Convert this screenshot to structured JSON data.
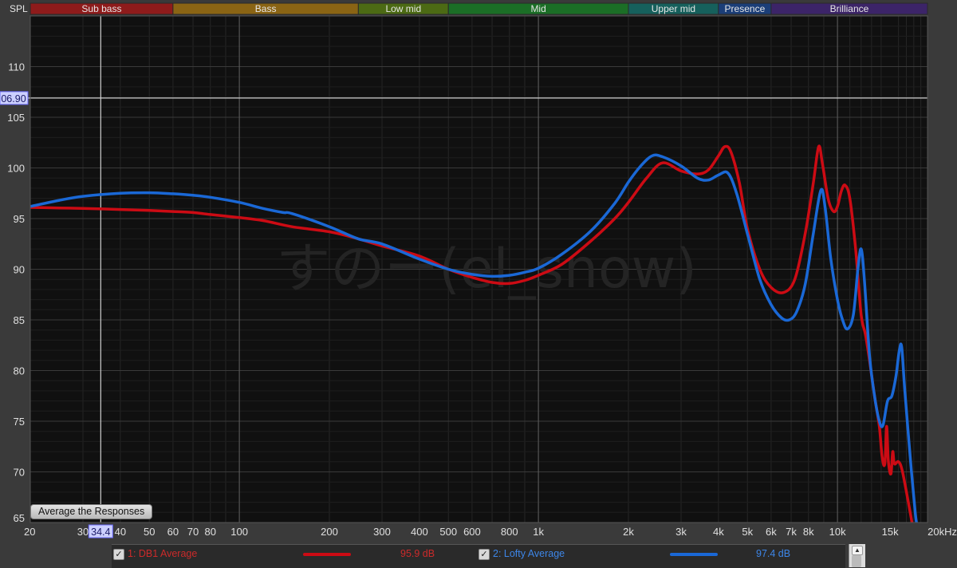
{
  "chart_data": {
    "type": "line",
    "y_axis_title": "SPL",
    "x_axis_unit": "Hz",
    "x_scale": "log",
    "xlim": [
      20,
      20000
    ],
    "ylim": [
      65,
      115
    ],
    "y_ticks": [
      65,
      70,
      75,
      80,
      85,
      90,
      95,
      100,
      105,
      110
    ],
    "y_tick_labels": [
      "65",
      "70",
      "75",
      "80",
      "85",
      "90",
      "95",
      "100",
      "105",
      "110"
    ],
    "x_ticks": [
      20,
      30,
      40,
      50,
      60,
      70,
      80,
      100,
      200,
      300,
      400,
      500,
      600,
      800,
      1000,
      2000,
      3000,
      4000,
      5000,
      6000,
      7000,
      8000,
      10000,
      15000,
      20000
    ],
    "x_tick_labels": [
      "20",
      "30",
      "40",
      "50",
      "60",
      "70",
      "80",
      "100",
      "200",
      "300",
      "400",
      "500",
      "600",
      "800",
      "1k",
      "2k",
      "3k",
      "4k",
      "5k",
      "6k",
      "7k",
      "8k",
      "10k",
      "15k",
      "20kHz"
    ],
    "grid": true,
    "watermark": "すのー(el_snow)",
    "cursor": {
      "freq": 34.4,
      "freq_label": "34.4",
      "spl": 106.9,
      "spl_label": "06.90"
    },
    "bands": [
      {
        "name": "Sub bass",
        "from": 20,
        "to": 60,
        "color": "#8e1b1b"
      },
      {
        "name": "Bass",
        "from": 60,
        "to": 250,
        "color": "#8a6414"
      },
      {
        "name": "Low mid",
        "from": 250,
        "to": 500,
        "color": "#4c6a14"
      },
      {
        "name": "Mid",
        "from": 500,
        "to": 2000,
        "color": "#1b6e26"
      },
      {
        "name": "Upper mid",
        "from": 2000,
        "to": 4000,
        "color": "#16605c"
      },
      {
        "name": "Presence",
        "from": 4000,
        "to": 6000,
        "color": "#1b3e78"
      },
      {
        "name": "Brilliance",
        "from": 6000,
        "to": 20000,
        "color": "#3c2468"
      }
    ],
    "series": [
      {
        "name": "1: DB1 Average",
        "color": "#cc0b14",
        "value_label": "95.9 dB",
        "points": [
          [
            20,
            96.1
          ],
          [
            25,
            96.05
          ],
          [
            30,
            96.0
          ],
          [
            40,
            95.9
          ],
          [
            50,
            95.8
          ],
          [
            60,
            95.7
          ],
          [
            70,
            95.6
          ],
          [
            80,
            95.4
          ],
          [
            100,
            95.1
          ],
          [
            120,
            94.8
          ],
          [
            150,
            94.2
          ],
          [
            200,
            93.7
          ],
          [
            250,
            93.0
          ],
          [
            300,
            92.3
          ],
          [
            400,
            91.3
          ],
          [
            500,
            90.0
          ],
          [
            600,
            89.2
          ],
          [
            700,
            88.7
          ],
          [
            800,
            88.6
          ],
          [
            900,
            88.9
          ],
          [
            1000,
            89.4
          ],
          [
            1200,
            90.5
          ],
          [
            1500,
            92.8
          ],
          [
            1800,
            95.0
          ],
          [
            2000,
            96.6
          ],
          [
            2300,
            99.0
          ],
          [
            2600,
            100.5
          ],
          [
            3000,
            99.7
          ],
          [
            3400,
            99.4
          ],
          [
            3700,
            99.8
          ],
          [
            4000,
            101.2
          ],
          [
            4200,
            102.1
          ],
          [
            4400,
            101.6
          ],
          [
            4700,
            98.5
          ],
          [
            5000,
            94.0
          ],
          [
            5500,
            90.0
          ],
          [
            6000,
            88.2
          ],
          [
            6600,
            87.7
          ],
          [
            7200,
            89.0
          ],
          [
            7800,
            93.5
          ],
          [
            8300,
            98.5
          ],
          [
            8650,
            102.1
          ],
          [
            8900,
            100.5
          ],
          [
            9300,
            97.0
          ],
          [
            9700,
            95.7
          ],
          [
            10000,
            96.2
          ],
          [
            10300,
            97.7
          ],
          [
            10600,
            98.3
          ],
          [
            11000,
            97.0
          ],
          [
            11500,
            92.0
          ],
          [
            12000,
            85.5
          ],
          [
            12400,
            83.6
          ],
          [
            12800,
            81.0
          ],
          [
            13300,
            77.5
          ],
          [
            13800,
            74.5
          ],
          [
            14100,
            71.5
          ],
          [
            14400,
            70.8
          ],
          [
            14600,
            74.5
          ],
          [
            14800,
            71.0
          ],
          [
            15100,
            69.8
          ],
          [
            15300,
            72.0
          ],
          [
            15500,
            70.8
          ],
          [
            16000,
            71.0
          ],
          [
            16500,
            70.0
          ],
          [
            17500,
            66.0
          ],
          [
            18000,
            64.0
          ]
        ]
      },
      {
        "name": "2: Lofty Average",
        "color": "#1a68d6",
        "value_label": "97.4 dB",
        "points": [
          [
            20,
            96.2
          ],
          [
            25,
            96.8
          ],
          [
            30,
            97.2
          ],
          [
            40,
            97.5
          ],
          [
            50,
            97.55
          ],
          [
            60,
            97.45
          ],
          [
            70,
            97.3
          ],
          [
            80,
            97.1
          ],
          [
            100,
            96.6
          ],
          [
            120,
            96.0
          ],
          [
            140,
            95.6
          ],
          [
            150,
            95.5
          ],
          [
            200,
            94.2
          ],
          [
            250,
            93.0
          ],
          [
            300,
            92.5
          ],
          [
            400,
            91.0
          ],
          [
            500,
            90.0
          ],
          [
            600,
            89.5
          ],
          [
            700,
            89.3
          ],
          [
            800,
            89.4
          ],
          [
            900,
            89.7
          ],
          [
            1000,
            90.1
          ],
          [
            1200,
            91.5
          ],
          [
            1500,
            93.8
          ],
          [
            1800,
            96.5
          ],
          [
            2000,
            98.6
          ],
          [
            2200,
            100.2
          ],
          [
            2400,
            101.2
          ],
          [
            2600,
            101.1
          ],
          [
            3000,
            100.2
          ],
          [
            3400,
            99.0
          ],
          [
            3700,
            98.8
          ],
          [
            4000,
            99.3
          ],
          [
            4300,
            99.5
          ],
          [
            4600,
            97.5
          ],
          [
            5000,
            93.5
          ],
          [
            5500,
            89.0
          ],
          [
            6000,
            86.5
          ],
          [
            6500,
            85.2
          ],
          [
            6900,
            85.0
          ],
          [
            7300,
            85.8
          ],
          [
            7800,
            88.5
          ],
          [
            8300,
            93.5
          ],
          [
            8800,
            97.8
          ],
          [
            9100,
            96.0
          ],
          [
            9500,
            91.0
          ],
          [
            10000,
            87.0
          ],
          [
            10400,
            85.0
          ],
          [
            10800,
            84.1
          ],
          [
            11300,
            85.5
          ],
          [
            11700,
            90.0
          ],
          [
            12000,
            92.0
          ],
          [
            12300,
            89.0
          ],
          [
            12800,
            81.5
          ],
          [
            13300,
            77.5
          ],
          [
            13800,
            75.0
          ],
          [
            14200,
            74.6
          ],
          [
            14700,
            77.0
          ],
          [
            15200,
            77.5
          ],
          [
            15700,
            79.5
          ],
          [
            16100,
            82.0
          ],
          [
            16400,
            82.3
          ],
          [
            16800,
            78.0
          ],
          [
            17500,
            71.5
          ],
          [
            18200,
            66.0
          ],
          [
            18500,
            64.5
          ]
        ]
      }
    ]
  },
  "controls": {
    "average_button": "Average the Responses",
    "checkbox_glyph": "✓",
    "scroll_up_glyph": "▲"
  }
}
